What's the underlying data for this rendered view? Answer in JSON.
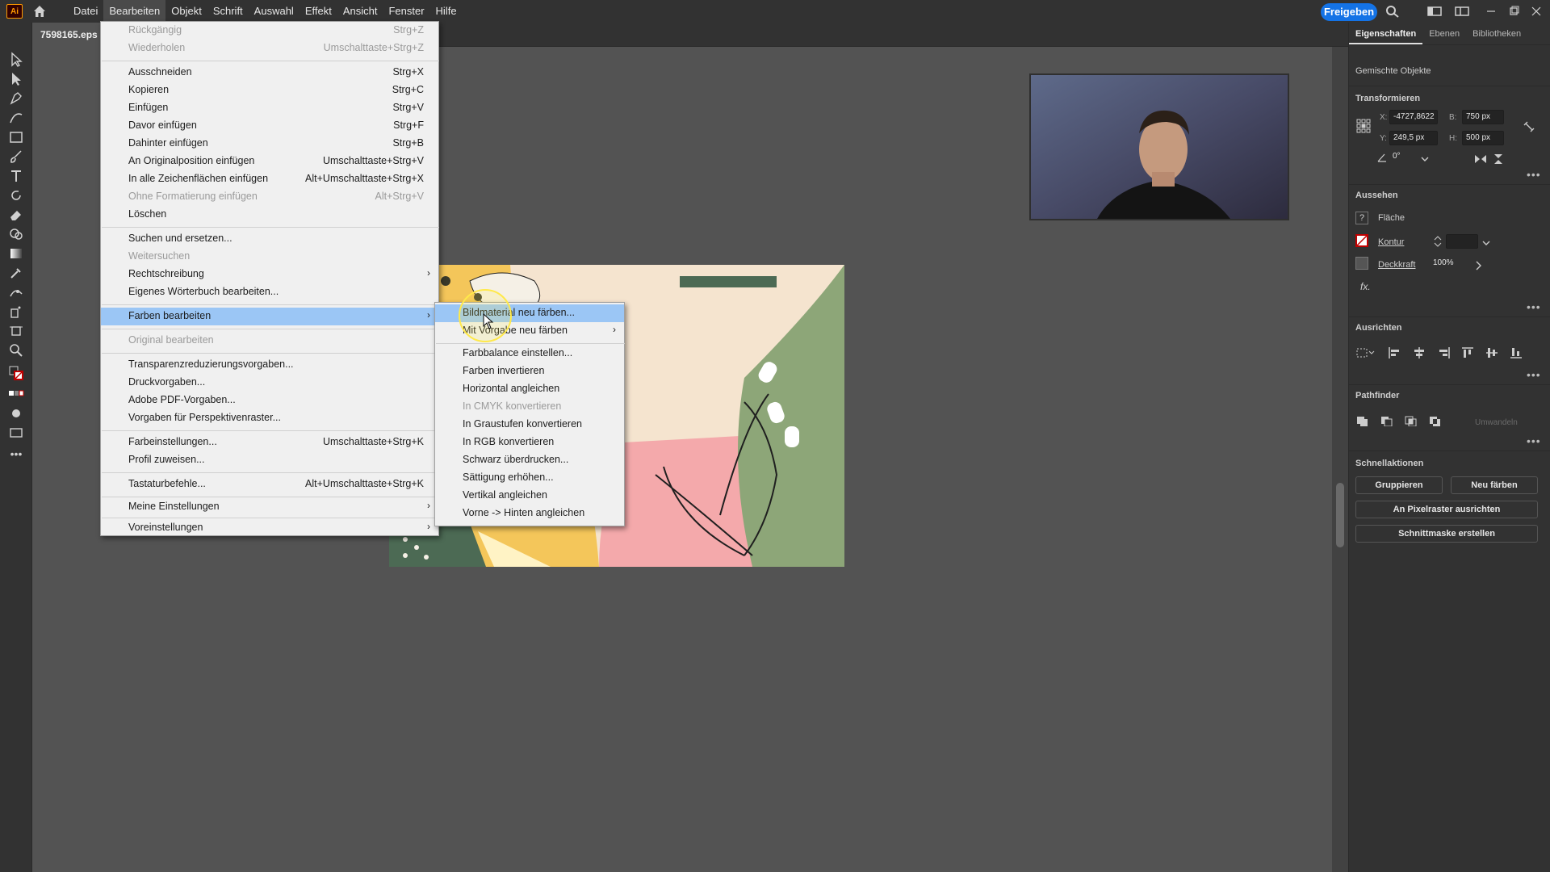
{
  "app": {
    "logo": "Ai",
    "colors": {
      "accent": "#1473e6",
      "menu_highlight": "#9bc6f5",
      "logo": "#ff9a00",
      "chrome": "#323232",
      "canvas": "#535353"
    }
  },
  "menubar": {
    "items": [
      "Datei",
      "Bearbeiten",
      "Objekt",
      "Schrift",
      "Auswahl",
      "Effekt",
      "Ansicht",
      "Fenster",
      "Hilfe"
    ],
    "share_label": "Freigeben"
  },
  "document": {
    "tab_title": "7598165.eps @"
  },
  "edit_menu": [
    {
      "label": "Rückgängig",
      "shortcut": "Strg+Z",
      "disabled": true
    },
    {
      "label": "Wiederholen",
      "shortcut": "Umschalttaste+Strg+Z",
      "disabled": true
    },
    {
      "label": "Ausschneiden",
      "shortcut": "Strg+X"
    },
    {
      "label": "Kopieren",
      "shortcut": "Strg+C"
    },
    {
      "label": "Einfügen",
      "shortcut": "Strg+V"
    },
    {
      "label": "Davor einfügen",
      "shortcut": "Strg+F"
    },
    {
      "label": "Dahinter einfügen",
      "shortcut": "Strg+B"
    },
    {
      "label": "An Originalposition einfügen",
      "shortcut": "Umschalttaste+Strg+V"
    },
    {
      "label": "In alle Zeichenflächen einfügen",
      "shortcut": "Alt+Umschalttaste+Strg+X"
    },
    {
      "label": "Ohne Formatierung einfügen",
      "shortcut": "Alt+Strg+V",
      "disabled": true
    },
    {
      "label": "Löschen",
      "shortcut": ""
    },
    {
      "label": "Suchen und ersetzen...",
      "shortcut": ""
    },
    {
      "label": "Weitersuchen",
      "shortcut": "",
      "disabled": true
    },
    {
      "label": "Rechtschreibung",
      "shortcut": "",
      "submenu": true
    },
    {
      "label": "Eigenes Wörterbuch bearbeiten...",
      "shortcut": ""
    },
    {
      "label": "Farben bearbeiten",
      "shortcut": "",
      "submenu": true,
      "highlighted": true
    },
    {
      "label": "Original bearbeiten",
      "shortcut": "",
      "disabled": true
    },
    {
      "label": "Transparenzreduzierungsvorgaben...",
      "shortcut": ""
    },
    {
      "label": "Druckvorgaben...",
      "shortcut": ""
    },
    {
      "label": "Adobe PDF-Vorgaben...",
      "shortcut": ""
    },
    {
      "label": "Vorgaben für Perspektivenraster...",
      "shortcut": ""
    },
    {
      "label": "Farbeinstellungen...",
      "shortcut": "Umschalttaste+Strg+K"
    },
    {
      "label": "Profil zuweisen...",
      "shortcut": ""
    },
    {
      "label": "Tastaturbefehle...",
      "shortcut": "Alt+Umschalttaste+Strg+K"
    },
    {
      "label": "Meine Einstellungen",
      "shortcut": "",
      "submenu": true
    },
    {
      "label": "Voreinstellungen",
      "shortcut": "",
      "submenu": true
    }
  ],
  "colors_submenu": [
    {
      "label": "Bildmaterial neu färben...",
      "highlighted": true
    },
    {
      "label": "Mit Vorgabe neu färben",
      "submenu": true
    },
    {
      "label": "Farbbalance einstellen..."
    },
    {
      "label": "Farben invertieren"
    },
    {
      "label": "Horizontal angleichen"
    },
    {
      "label": "In CMYK konvertieren",
      "disabled": true
    },
    {
      "label": "In Graustufen konvertieren"
    },
    {
      "label": "In RGB konvertieren"
    },
    {
      "label": "Schwarz überdrucken..."
    },
    {
      "label": "Sättigung erhöhen..."
    },
    {
      "label": "Vertikal angleichen"
    },
    {
      "label": "Vorne -> Hinten angleichen"
    }
  ],
  "panel": {
    "tabs": [
      "Eigenschaften",
      "Ebenen",
      "Bibliotheken"
    ],
    "selection_type": "Gemischte Objekte",
    "transform": {
      "title": "Transformieren",
      "x_label": "X:",
      "x": "-4727,8622",
      "y_label": "Y:",
      "y": "249,5 px",
      "w_label": "B:",
      "w": "750 px",
      "h_label": "H:",
      "h": "500 px",
      "angle": "0°"
    },
    "appearance": {
      "title": "Aussehen",
      "fill": "Fläche",
      "stroke": "Kontur",
      "opacity_label": "Deckkraft",
      "opacity": "100%",
      "fx": "fx."
    },
    "align_title": "Ausrichten",
    "pathfinder_title": "Pathfinder",
    "pathfinder_expand": "Umwandeln",
    "quick_actions": {
      "title": "Schnellaktionen",
      "group": "Gruppieren",
      "recolor": "Neu färben",
      "pixel_align": "An Pixelraster ausrichten",
      "clip_mask": "Schnittmaske erstellen"
    }
  }
}
